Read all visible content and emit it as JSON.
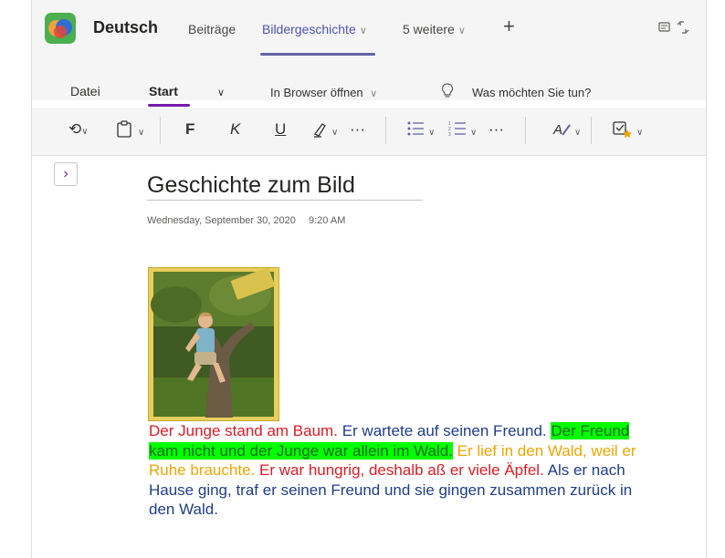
{
  "teams": {
    "team_name": "Deutsch",
    "tabs": [
      {
        "label": "Beiträge"
      },
      {
        "label": "Bildergeschichte"
      },
      {
        "label": "5 weitere"
      }
    ]
  },
  "ribbon": {
    "menu": {
      "file": "Datei",
      "start": "Start",
      "open_browser": "In Browser öffnen",
      "tell_me": "Was möchten Sie tun?"
    },
    "toolbar": {
      "bold": "F",
      "italic": "K",
      "underline": "U",
      "more": "···"
    }
  },
  "page": {
    "title": "Geschichte zum Bild",
    "date": "Wednesday, September 30, 2020",
    "time": "9:20 AM",
    "story": {
      "s1": "Der Junge stand am Baum.",
      "s2": "Er wartete auf seinen Freund.",
      "s3": "Der Freund kam nicht und der Junge war allein im Wald.",
      "s4": "Er lief in den Wald, weil er Ruhe brauchte.",
      "s5": "Er war hungrig, deshalb aß er viele Äpfel.",
      "s6": "Als er nach Hause ging, traf er seinen Freund und sie gingen zusammen zurück in den Wald."
    }
  },
  "colors": {
    "accent_purple": "#6264a7",
    "story_red": "#e01b24",
    "story_highlight": "#00ff00",
    "story_orange": "#f0a500",
    "story_blue": "#1f3d8a"
  },
  "icons": [
    "app-logo-icon",
    "chevron-down-icon",
    "plus-icon",
    "expand-icon",
    "lightbulb-icon",
    "undo-icon",
    "clipboard-icon",
    "highlighter-icon",
    "bullet-list-icon",
    "numbered-list-icon",
    "styles-icon",
    "tag-icon",
    "expand-panel-icon"
  ]
}
